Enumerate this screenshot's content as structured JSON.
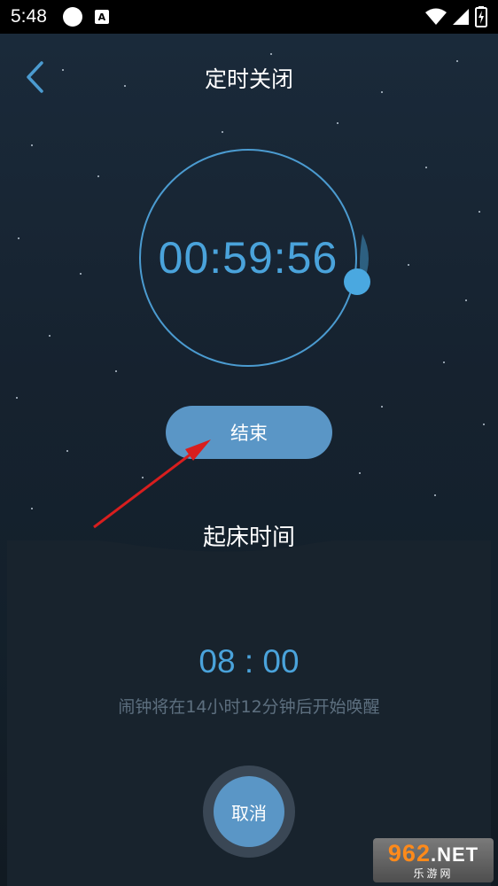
{
  "status_bar": {
    "time": "5:48",
    "notification_icon_letter": "A",
    "icons": [
      "circle-icon",
      "a-badge-icon",
      "wifi-icon",
      "signal-icon",
      "battery-icon"
    ]
  },
  "header": {
    "title": "定时关闭",
    "back_icon": "chevron-left-icon"
  },
  "timer": {
    "countdown": "00:59:56",
    "ring_color": "#4b9bd0",
    "text_color": "#4aa3db"
  },
  "end_button": {
    "label": "结束",
    "color": "#5a96c6"
  },
  "wake": {
    "title": "起床时间",
    "alarm_time": "08 : 00",
    "note": "闹钟将在14小时12分钟后开始唤醒"
  },
  "cancel_button": {
    "label": "取消"
  },
  "watermark": {
    "digits": "962",
    "suffix": ".NET",
    "caption": "乐游网"
  },
  "annotation_arrow_color": "#d81e1e"
}
